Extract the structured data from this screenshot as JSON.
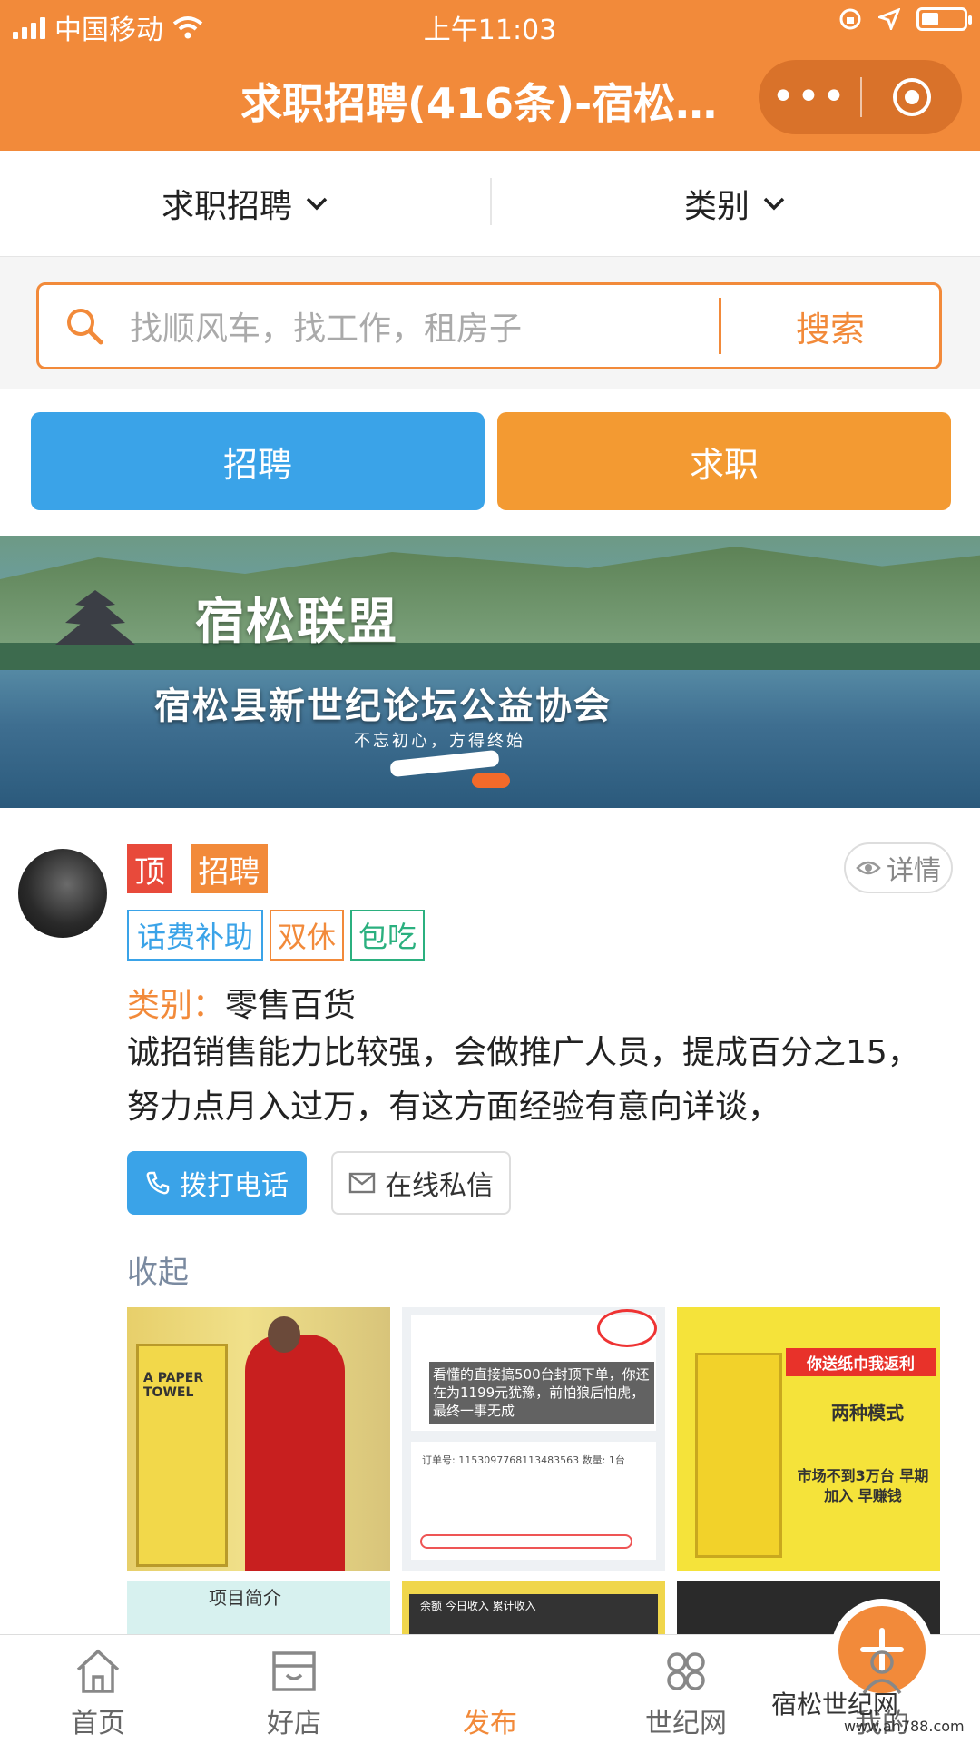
{
  "status": {
    "carrier": "中国移动",
    "time": "上午11:03"
  },
  "titlebar": {
    "title": "求职招聘(416条)-宿松…"
  },
  "filters": [
    {
      "label": "求职招聘"
    },
    {
      "label": "类别"
    }
  ],
  "search": {
    "placeholder": "找顺风车，找工作，租房子",
    "button": "搜索"
  },
  "actions": {
    "recruit": "招聘",
    "seek": "求职"
  },
  "banner": {
    "title": "宿松联盟",
    "subtitle": "宿松县新世纪论坛公益协会",
    "slogan": "不忘初心，方得终始"
  },
  "post": {
    "tag_top": "顶",
    "tag_type": "招聘",
    "detail_button": "详情",
    "benefits": [
      "话费补助",
      "双休",
      "包吃"
    ],
    "category_key": "类别：",
    "category_value": "零售百货",
    "description": "诚招销售能力比较强，会做推广人员，提成百分之15，努力点月入过万，有这方面经验有意向详谈，",
    "call_button": "拨打电话",
    "message_button": "在线私信",
    "collapse": "收起",
    "thumbs": {
      "t1": "A PAPER TOWEL",
      "t2a": "看懂的直接搞500台封顶下单，你还在为1199元犹豫，前怕狼后怕虎，最终一事无成",
      "t2b": "订单号: 1153097768113483563  数量: 1台",
      "t3a": "你送纸巾我返利",
      "t3b": "两种模式",
      "t3c": "市场不到3万台 早期加入 早赚钱",
      "t4": "项目简介",
      "t5": "余额  今日收入  累计收入"
    }
  },
  "tabs": [
    {
      "label": "首页",
      "icon": "home-icon"
    },
    {
      "label": "好店",
      "icon": "store-icon"
    },
    {
      "label": "发布",
      "icon": "plus-icon"
    },
    {
      "label": "世纪网",
      "icon": "grid-icon"
    },
    {
      "label": "我的",
      "icon": "user-icon"
    }
  ],
  "watermark": {
    "text": "宿松世纪网",
    "url": "www.ah788.com"
  },
  "colors": {
    "brand": "#f28a3a",
    "blue": "#3aa3e8",
    "orange": "#f39a32",
    "green": "#2bb07f",
    "red": "#e84a3b"
  }
}
